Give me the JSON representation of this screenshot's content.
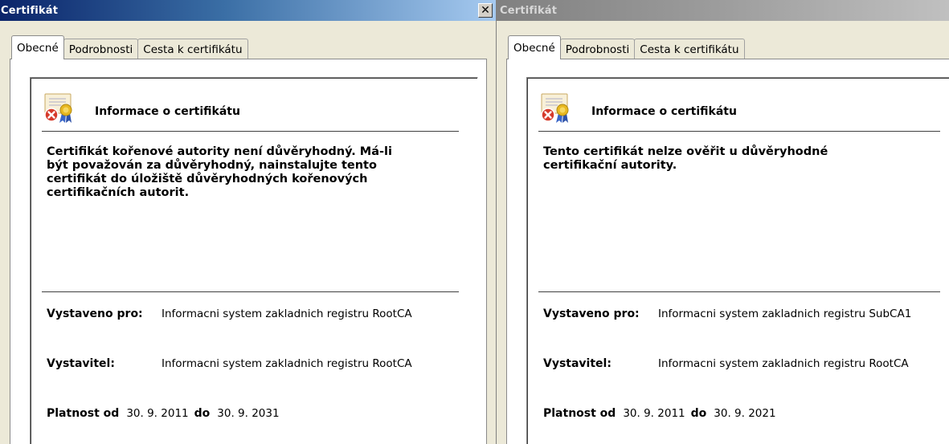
{
  "windows": [
    {
      "id": "left",
      "title": "Certifikát",
      "close_glyph": "✕",
      "tabs": [
        "Obecné",
        "Podrobnosti",
        "Cesta k certifikátu"
      ],
      "active_tab": "Obecné",
      "icon": "certificate-error-icon",
      "heading": "Informace o certifikátu",
      "message": "Certifikát kořenové autority není důvěryhodný. Má-li\nbýt považován za důvěryhodný, nainstalujte tento\ncertifikát do úložiště důvěryhodných kořenových\ncertifikačních autorit.",
      "issued_to_label": "Vystaveno pro:",
      "issued_to": "Informacni system zakladnich registru RootCA",
      "issuer_label": "Vystavitel:",
      "issuer": "Informacni system zakladnich registru RootCA",
      "valid_from_label": "Platnost od",
      "valid_from": "30. 9. 2011",
      "valid_to_label": "do",
      "valid_to": "30. 9. 2031"
    },
    {
      "id": "right",
      "title": "Certifikát",
      "tabs": [
        "Obecné",
        "Podrobnosti",
        "Cesta k certifikátu"
      ],
      "active_tab": "Obecné",
      "icon": "certificate-error-icon",
      "heading": "Informace o certifikátu",
      "message": "Tento certifikát nelze ověřit u důvěryhodné\ncertifikační autority.",
      "issued_to_label": "Vystaveno pro:",
      "issued_to": "Informacni system zakladnich registru SubCA1",
      "issuer_label": "Vystavitel:",
      "issuer": "Informacni system zakladnich registru RootCA",
      "valid_from_label": "Platnost od",
      "valid_from": "30. 9. 2011",
      "valid_to_label": "do",
      "valid_to": "30. 9. 2021"
    }
  ],
  "colors": {
    "titlebar_active": "#0a246a",
    "titlebar_inactive": "#808080",
    "dialog_face": "#ece9d8",
    "error_red": "#d63a2a",
    "seal_gold": "#e8b820",
    "ribbon_blue": "#3a66c8"
  }
}
